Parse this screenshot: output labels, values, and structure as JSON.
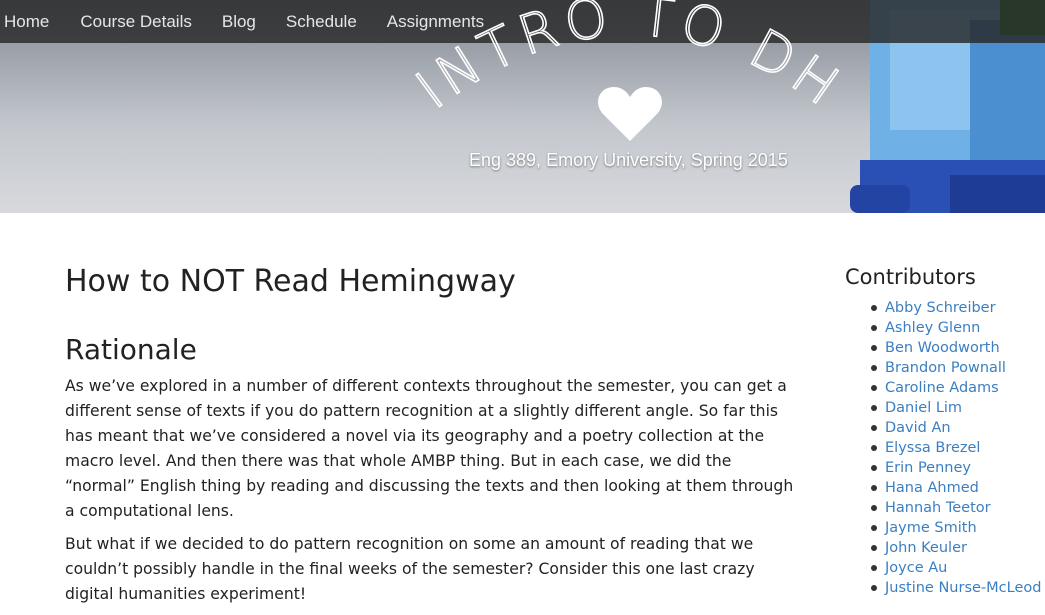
{
  "nav": {
    "items": [
      {
        "label": "Home"
      },
      {
        "label": "Course Details"
      },
      {
        "label": "Blog"
      },
      {
        "label": "Schedule"
      },
      {
        "label": "Assignments"
      }
    ]
  },
  "header": {
    "site_title": "INTRO TO DH",
    "subtitle": "Eng 389, Emory University, Spring 2015",
    "logo_icon": "heart-icon"
  },
  "post": {
    "title": "How to NOT Read Hemingway",
    "section_heading": "Rationale",
    "paragraphs": [
      "As we’ve explored in a number of different contexts throughout the semester, you can get a different sense of texts if you do pattern recognition at a slightly different angle. So far this has meant that we’ve considered a novel via its geography and a poetry collection at the macro level. And then there was that whole AMBP thing. But in each case, we did the “normal” English thing by reading and discussing the texts and then looking at them through a computational lens.",
      "But what if we decided to do pattern recognition on some an amount of reading that we couldn’t possibly handle in the final weeks of the semester? Consider this one last crazy digital humanities experiment!"
    ]
  },
  "sidebar": {
    "title": "Contributors",
    "contributors": [
      "Abby Schreiber",
      "Ashley Glenn",
      "Ben Woodworth",
      "Brandon Pownall",
      "Caroline Adams",
      "Daniel Lim",
      "David An",
      "Elyssa Brezel",
      "Erin Penney",
      "Hana Ahmed",
      "Hannah Teetor",
      "Jayme Smith",
      "John Keuler",
      "Joyce Au",
      "Justine Nurse-McLeod"
    ]
  },
  "colors": {
    "link": "#3a7fc1",
    "navbar_bg": "#282828",
    "text": "#222222"
  }
}
